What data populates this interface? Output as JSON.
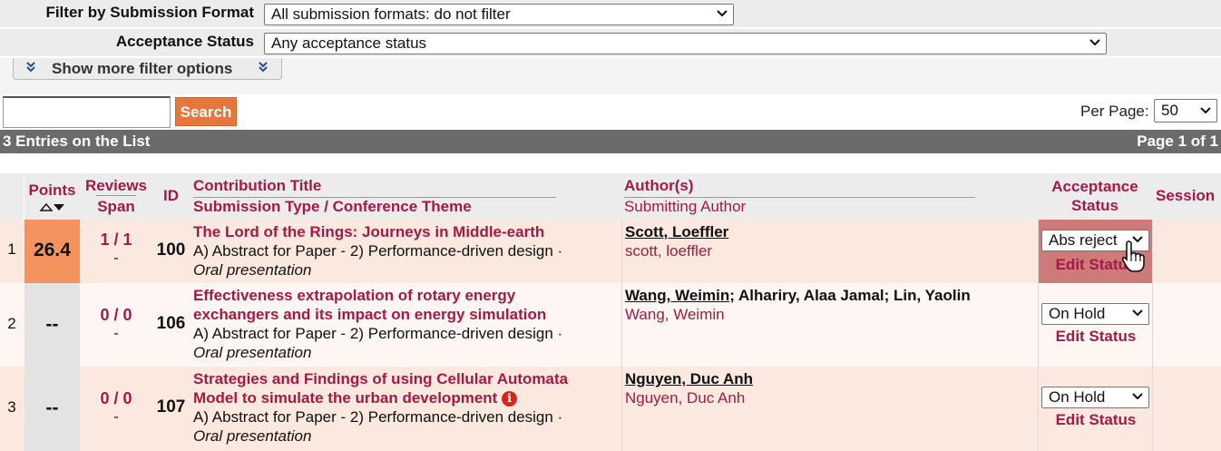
{
  "filters": {
    "format_label": "Filter by Submission Format",
    "format_value": "All submission formats: do not filter",
    "acceptance_label": "Acceptance Status",
    "acceptance_value": "Any acceptance status",
    "more_label": "Show more filter options"
  },
  "search": {
    "button_label": "Search",
    "value": "",
    "per_page_label": "Per Page:",
    "per_page_value": "50"
  },
  "list": {
    "entries_label": "3 Entries on the List",
    "page_label": "Page 1 of 1"
  },
  "columns": {
    "points": "Points",
    "reviews": "Reviews",
    "span": "Span",
    "id": "ID",
    "contribution_title": "Contribution Title",
    "submission_type": "Submission Type / Conference Theme",
    "authors": "Author(s)",
    "submitting_author": "Submitting Author",
    "acceptance_line1": "Acceptance",
    "acceptance_line2": "Status",
    "session": "Session"
  },
  "rows": [
    {
      "num": "1",
      "points": "26.4",
      "reviews": "1 / 1",
      "span": "-",
      "id": "100",
      "title": "The Lord of the Rings: Journeys in Middle-earth",
      "type": "A) Abstract for Paper - 2) Performance-driven design ·",
      "presentation": "Oral presentation",
      "authors_underlined": "Scott, Loeffler",
      "authors_rest": "",
      "submitting": "scott, loeffler",
      "status": "Abs reject",
      "edit_label": "Edit Status"
    },
    {
      "num": "2",
      "points": "--",
      "reviews": "0 / 0",
      "span": "-",
      "id": "106",
      "title_line1": "Effectiveness extrapolation of rotary energy",
      "title_line2": "exchangers and its impact on energy simulation",
      "type": "A) Abstract for Paper - 2) Performance-driven design ·",
      "presentation": "Oral presentation",
      "authors_underlined": "Wang, Weimin",
      "authors_rest": "; Alhariry, Alaa Jamal; Lin, Yaolin",
      "submitting": "Wang, Weimin",
      "status": "On Hold",
      "edit_label": "Edit Status"
    },
    {
      "num": "3",
      "points": "--",
      "reviews": "0 / 0",
      "span": "-",
      "id": "107",
      "title_line1": "Strategies and Findings of using Cellular Automata",
      "title_line2": "Model to simulate the urban development",
      "info_icon_glyph": "i",
      "type": "A) Abstract for Paper - 2) Performance-driven design ·",
      "presentation": "Oral presentation",
      "authors_underlined": "Nguyen, Duc Anh",
      "authors_rest": "",
      "submitting": "Nguyen, Duc Anh",
      "status": "On Hold",
      "edit_label": "Edit Status"
    }
  ],
  "icons": {
    "sort": "sort-arrows-icon",
    "dropdown": "chevron-down-icon",
    "more": "double-chevron-down-icon",
    "info": "info-icon",
    "cursor": "hand-pointer-icon"
  },
  "colors": {
    "accent": "#a31a45",
    "search_button": "#e8763b",
    "points_highlight": "#f4935e",
    "status_highlight": "#cd7a78",
    "list_bar": "#6b6b6b"
  }
}
